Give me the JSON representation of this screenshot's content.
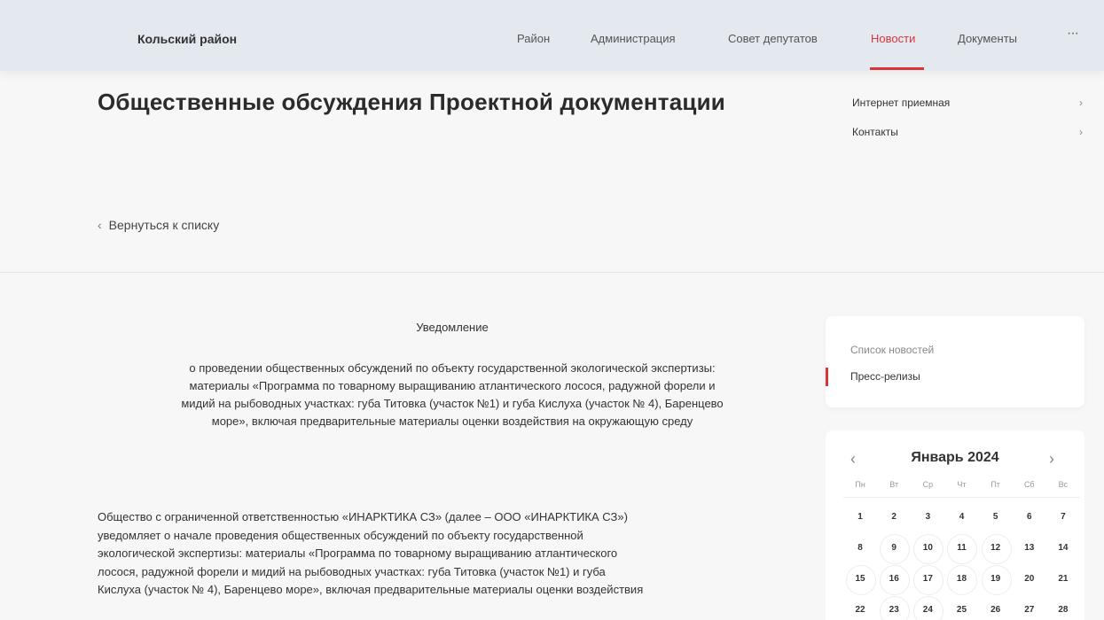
{
  "header": {
    "brand": "Кольский район",
    "nav": [
      {
        "label": "Район",
        "active": false
      },
      {
        "label": "Администрация",
        "active": false
      },
      {
        "label": "Совет депутатов",
        "active": false
      },
      {
        "label": "Новости",
        "active": true
      },
      {
        "label": "Документы",
        "active": false
      }
    ],
    "more": "···"
  },
  "page": {
    "title": "Общественные обсуждения Проектной документации",
    "side_links": [
      "Интернет приемная",
      "Контакты"
    ],
    "back_label": "Вернуться к списку"
  },
  "content": {
    "notice_title": "Уведомление",
    "notice_sub": [
      "о проведении общественных обсуждений по объекту государственной экологической экспертизы:",
      "материалы «Программа по товарному выращиванию атлантического лосося, радужной форели и",
      "мидий на рыбоводных участках: губа Титовка (участок №1) и губа Кислуха (участок № 4), Баренцево",
      "море», включая предварительные материалы оценки воздействия на окружающую среду"
    ],
    "body": [
      "Общество с ограниченной ответственностью «ИНАРКТИКА СЗ» (далее – ООО «ИНАРКТИКА СЗ»)",
      "уведомляет о начале проведения общественных обсуждений по объекту государственной",
      "экологической экспертизы: материалы «Программа по товарному выращиванию атлантического",
      "лосося, радужной форели и мидий на рыбоводных участках: губа Титовка (участок №1) и губа",
      "Кислуха (участок № 4), Баренцево море», включая предварительные материалы оценки воздействия"
    ]
  },
  "news_menu": {
    "items": [
      "Список новостей",
      "Пресс-релизы"
    ],
    "active_index": 1
  },
  "calendar": {
    "title": "Январь 2024",
    "weekdays": [
      "Пн",
      "Вт",
      "Ср",
      "Чт",
      "Пт",
      "Сб",
      "Вс"
    ],
    "days": [
      "1",
      "2",
      "3",
      "4",
      "5",
      "6",
      "7",
      "8",
      "9",
      "10",
      "11",
      "12",
      "13",
      "14",
      "15",
      "16",
      "17",
      "18",
      "19",
      "20",
      "21",
      "22",
      "23",
      "24",
      "25",
      "26",
      "27",
      "28"
    ],
    "highlighted_days": [
      "9",
      "10",
      "11",
      "12",
      "15",
      "16",
      "17",
      "18",
      "19",
      "23",
      "24"
    ],
    "prev_icon": "chevron-left-icon",
    "next_icon": "chevron-right-icon"
  },
  "colors": {
    "accent": "#d9343c",
    "header_bg": "#e3e9ef",
    "page_bg": "#f7f7f7"
  }
}
